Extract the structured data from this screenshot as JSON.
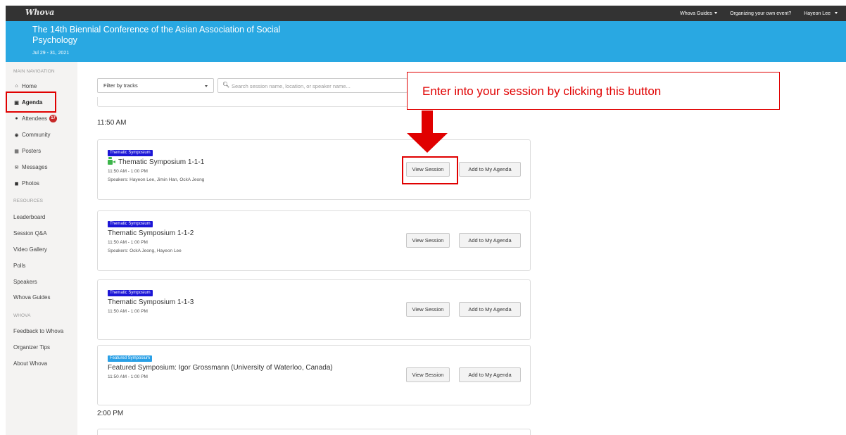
{
  "topbar": {
    "logo": "Whova",
    "guides_label": "Whova Guides",
    "organizing_label": "Organizing your own event?",
    "user_name": "Hayeon Lee"
  },
  "event": {
    "title": "The 14th Biennial Conference of the Asian Association of Social Psychology",
    "dates": "Jul 29 - 31, 2021"
  },
  "sidebar": {
    "main_nav_heading": "MAIN NAVIGATION",
    "main_items": [
      {
        "label": "Home",
        "icon": "home-icon"
      },
      {
        "label": "Agenda",
        "icon": "calendar-icon",
        "active": true
      },
      {
        "label": "Attendees",
        "icon": "users-icon",
        "badge": "17"
      },
      {
        "label": "Community",
        "icon": "chat-icon"
      },
      {
        "label": "Posters",
        "icon": "poster-icon"
      },
      {
        "label": "Messages",
        "icon": "envelope-icon"
      },
      {
        "label": "Photos",
        "icon": "camera-icon"
      }
    ],
    "resources_heading": "RESOURCES",
    "resource_items": [
      "Leaderboard",
      "Session Q&A",
      "Video Gallery",
      "Polls",
      "Speakers",
      "Whova Guides"
    ],
    "whova_heading": "WHOVA",
    "whova_items": [
      "Feedback to Whova",
      "Organizer Tips",
      "About Whova"
    ]
  },
  "filters": {
    "track_select": "Filter by tracks",
    "search_placeholder": "Search session name, location, or speaker name..."
  },
  "schedule": {
    "time_1": "11:50 AM",
    "time_2": "2:00 PM",
    "sessions": [
      {
        "track": "Thematic Symposium",
        "title": "Thematic Symposium 1-1-1",
        "time": "11:50 AM - 1:00 PM",
        "speakers": "Speakers: Hayeon Lee, Jimin Han, OckA Jeong",
        "live": true
      },
      {
        "track": "Thematic Symposium",
        "title": "Thematic Symposium 1-1-2",
        "time": "11:50 AM - 1:00 PM",
        "speakers": "Speakers: OckA Jeong, Hayeon Lee"
      },
      {
        "track": "Thematic Symposium",
        "title": "Thematic Symposium 1-1-3",
        "time": "11:50 AM - 1:00 PM"
      },
      {
        "track": "Featured Symposium",
        "title": "Featured Symposium: Igor Grossmann (University of Waterloo, Canada)",
        "time": "11:50 AM - 1:00 PM"
      }
    ],
    "view_label": "View Session",
    "add_label": "Add to My Agenda"
  },
  "callout": {
    "text": "Enter into your session by clicking this button",
    "color": "#e00000"
  },
  "colors": {
    "topbar": "#333333",
    "event_banner": "#29a8e2",
    "thematic_tag": "#1c16d6",
    "featured_tag": "#2aa0e6",
    "highlight": "#e00000"
  }
}
